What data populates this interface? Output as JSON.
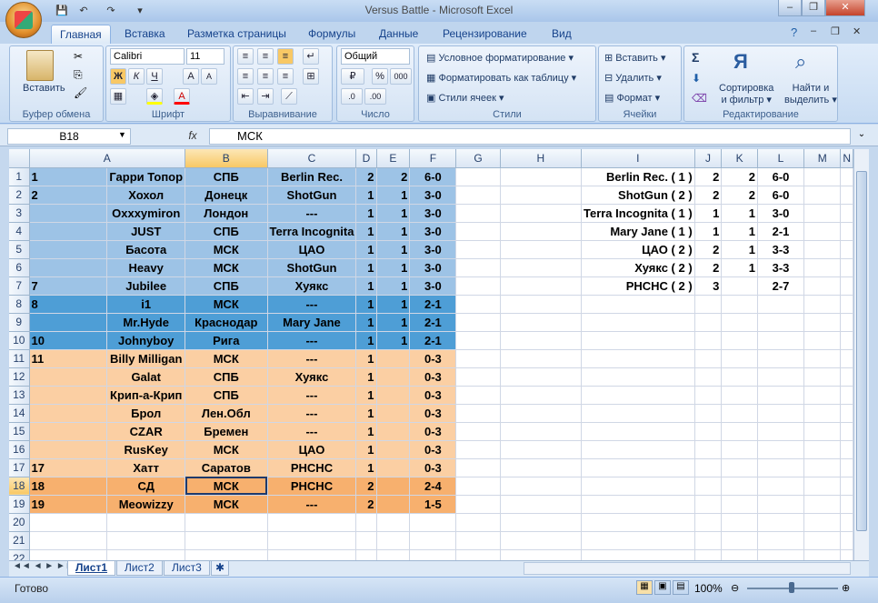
{
  "window": {
    "title": "Versus Battle - Microsoft Excel",
    "min": "–",
    "max": "❐",
    "close": "✕"
  },
  "qat": {
    "save": "💾",
    "undo": "↶",
    "redo": "↷",
    "more": "▾"
  },
  "tabs": [
    "Главная",
    "Вставка",
    "Разметка страницы",
    "Формулы",
    "Данные",
    "Рецензирование",
    "Вид"
  ],
  "ribbon": {
    "clipboard": {
      "label": "Буфер обмена",
      "paste": "Вставить"
    },
    "font": {
      "label": "Шрифт",
      "name": "Calibri",
      "size": "11",
      "bold": "Ж",
      "italic": "К",
      "underline": "Ч",
      "grow": "A",
      "shrink": "A"
    },
    "align": {
      "label": "Выравнивание"
    },
    "number": {
      "label": "Число",
      "format": "Общий",
      "pct": "%",
      "thousands": "000"
    },
    "styles": {
      "label": "Стили",
      "cond": "Условное форматирование",
      "table": "Форматировать как таблицу",
      "cell": "Стили ячеек"
    },
    "cells": {
      "label": "Ячейки",
      "insert": "Вставить",
      "delete": "Удалить",
      "format": "Формат"
    },
    "edit": {
      "label": "Редактирование",
      "sum": "Σ",
      "sort1": "Сортировка",
      "sort2": "и фильтр",
      "find1": "Найти и",
      "find2": "выделить"
    }
  },
  "formula_bar": {
    "cell": "B18",
    "fx": "fx",
    "value": "МСК"
  },
  "columns": [
    "A",
    "B",
    "C",
    "D",
    "E",
    "F",
    "G",
    "H",
    "I",
    "J",
    "K",
    "L",
    "M",
    "N"
  ],
  "rows": [
    {
      "n": "1",
      "a": "Гарри Топор",
      "a0": "1",
      "b": "СПБ",
      "c": "Berlin Rec.",
      "d": "2",
      "e": "2",
      "f": "6-0",
      "i": "Berlin Rec. ( 1 )",
      "j": "2",
      "k": "2",
      "l": "6-0"
    },
    {
      "n": "2",
      "a": "Хохол",
      "a0": "2",
      "b": "Донецк",
      "c": "ShotGun",
      "d": "1",
      "e": "1",
      "f": "3-0",
      "i": "ShotGun ( 2 )",
      "j": "2",
      "k": "2",
      "l": "6-0"
    },
    {
      "n": "3",
      "a": "Oxxxymiron",
      "a0": "",
      "b": "Лондон",
      "c": "---",
      "d": "1",
      "e": "1",
      "f": "3-0",
      "i": "Terra Incognita ( 1 )",
      "j": "1",
      "k": "1",
      "l": "3-0"
    },
    {
      "n": "4",
      "a": "JUST",
      "a0": "",
      "b": "СПБ",
      "c": "Terra Incognita",
      "d": "1",
      "e": "1",
      "f": "3-0",
      "i": "Mary Jane ( 1 )",
      "j": "1",
      "k": "1",
      "l": "2-1"
    },
    {
      "n": "5",
      "a": "Басота",
      "a0": "",
      "b": "МСК",
      "c": "ЦАО",
      "d": "1",
      "e": "1",
      "f": "3-0",
      "i": "ЦАО ( 2 )",
      "j": "2",
      "k": "1",
      "l": "3-3"
    },
    {
      "n": "6",
      "a": "Heavy",
      "a0": "",
      "b": "МСК",
      "c": "ShotGun",
      "d": "1",
      "e": "1",
      "f": "3-0",
      "i": "Хуякс ( 2 )",
      "j": "2",
      "k": "1",
      "l": "3-3"
    },
    {
      "n": "7",
      "a": "Jubilee",
      "a0": "7",
      "b": "СПБ",
      "c": "Хуякс",
      "d": "1",
      "e": "1",
      "f": "3-0",
      "i": "РНСНС ( 2 )",
      "j": "3",
      "k": "",
      "l": "2-7"
    },
    {
      "n": "8",
      "a": "i1",
      "a0": "8",
      "b": "МСК",
      "c": "---",
      "d": "1",
      "e": "1",
      "f": "2-1",
      "i": "",
      "j": "",
      "k": "",
      "l": ""
    },
    {
      "n": "9",
      "a": "Mr.Hyde",
      "a0": "",
      "b": "Краснодар",
      "c": "Mary Jane",
      "d": "1",
      "e": "1",
      "f": "2-1",
      "i": "",
      "j": "",
      "k": "",
      "l": ""
    },
    {
      "n": "10",
      "a": "Johnyboy",
      "a0": "10",
      "b": "Рига",
      "c": "---",
      "d": "1",
      "e": "1",
      "f": "2-1",
      "i": "",
      "j": "",
      "k": "",
      "l": ""
    },
    {
      "n": "11",
      "a": "Billy Milligan",
      "a0": "11",
      "b": "МСК",
      "c": "---",
      "d": "1",
      "e": "",
      "f": "0-3",
      "i": "",
      "j": "",
      "k": "",
      "l": ""
    },
    {
      "n": "12",
      "a": "Galat",
      "a0": "",
      "b": "СПБ",
      "c": "Хуякс",
      "d": "1",
      "e": "",
      "f": "0-3",
      "i": "",
      "j": "",
      "k": "",
      "l": ""
    },
    {
      "n": "13",
      "a": "Крип-а-Крип",
      "a0": "",
      "b": "СПБ",
      "c": "---",
      "d": "1",
      "e": "",
      "f": "0-3",
      "i": "",
      "j": "",
      "k": "",
      "l": ""
    },
    {
      "n": "14",
      "a": "Брол",
      "a0": "",
      "b": "Лен.Обл",
      "c": "---",
      "d": "1",
      "e": "",
      "f": "0-3",
      "i": "",
      "j": "",
      "k": "",
      "l": ""
    },
    {
      "n": "15",
      "a": "CZAR",
      "a0": "",
      "b": "Бремен",
      "c": "---",
      "d": "1",
      "e": "",
      "f": "0-3",
      "i": "",
      "j": "",
      "k": "",
      "l": ""
    },
    {
      "n": "16",
      "a": "RusKey",
      "a0": "",
      "b": "МСК",
      "c": "ЦАО",
      "d": "1",
      "e": "",
      "f": "0-3",
      "i": "",
      "j": "",
      "k": "",
      "l": ""
    },
    {
      "n": "17",
      "a": "Хатт",
      "a0": "17",
      "b": "Саратов",
      "c": "РНСНС",
      "d": "1",
      "e": "",
      "f": "0-3",
      "i": "",
      "j": "",
      "k": "",
      "l": ""
    },
    {
      "n": "18",
      "a": "СД",
      "a0": "18",
      "b": "МСК",
      "c": "РНСНС",
      "d": "2",
      "e": "",
      "f": "2-4",
      "i": "",
      "j": "",
      "k": "",
      "l": ""
    },
    {
      "n": "19",
      "a": "Meowizzy",
      "a0": "19",
      "b": "МСК",
      "c": "---",
      "d": "2",
      "e": "",
      "f": "1-5",
      "i": "",
      "j": "",
      "k": "",
      "l": ""
    },
    {
      "n": "20",
      "a": "",
      "a0": "",
      "b": "",
      "c": "",
      "d": "",
      "e": "",
      "f": "",
      "i": "",
      "j": "",
      "k": "",
      "l": ""
    },
    {
      "n": "21",
      "a": "",
      "a0": "",
      "b": "",
      "c": "",
      "d": "",
      "e": "",
      "f": "",
      "i": "",
      "j": "",
      "k": "",
      "l": ""
    },
    {
      "n": "22",
      "a": "",
      "a0": "",
      "b": "",
      "c": "",
      "d": "",
      "e": "",
      "f": "",
      "i": "",
      "j": "",
      "k": "",
      "l": ""
    }
  ],
  "row_colors": {
    "bl1": "#9dc3e6",
    "bl2": "#4e9ed6",
    "or1": "#fbcfa3",
    "or2": "#f7b06e"
  },
  "sheets": [
    "Лист1",
    "Лист2",
    "Лист3"
  ],
  "status": {
    "ready": "Готово",
    "zoom": "100%"
  }
}
